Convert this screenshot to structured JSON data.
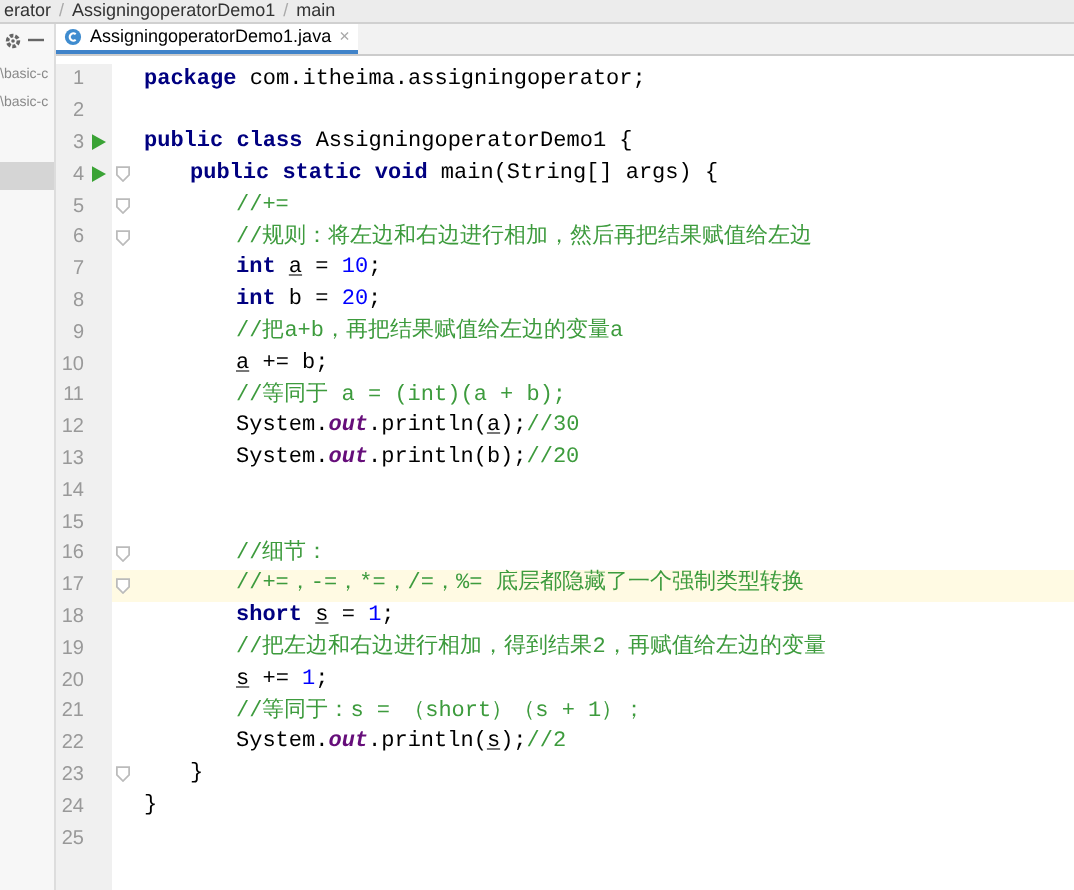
{
  "breadcrumb": {
    "separator": "/",
    "items": [
      "erator",
      "AssigningoperatorDemo1",
      "main"
    ]
  },
  "project_panel": {
    "items": [
      {
        "label": "\\basic-c",
        "selected": false
      },
      {
        "label": "\\basic-c",
        "selected": false
      },
      {
        "selected": true
      }
    ]
  },
  "tabs": [
    {
      "label": "AssigningoperatorDemo1.java",
      "selected": true,
      "close": "×"
    }
  ],
  "lines": [
    {
      "number": "1",
      "tokens": [
        {
          "kind": "kw",
          "text": "package"
        },
        {
          "kind": "plain",
          "text": " com.itheima.assigningoperator;"
        }
      ]
    },
    {
      "number": "2"
    },
    {
      "number": "3",
      "run": true,
      "tokens": [
        {
          "kind": "kw",
          "text": "public class"
        },
        {
          "kind": "plain",
          "text": " AssigningoperatorDemo1 {"
        }
      ],
      "children": [
        {
          "number": "4",
          "run": true,
          "fold": true,
          "tokens": [
            {
              "kind": "kw",
              "text": "public static void"
            },
            {
              "kind": "plain",
              "text": " main(String[] args) {"
            }
          ],
          "children": [
            {
              "number": "5",
              "fold": true,
              "tokens": [
                {
                  "kind": "comment",
                  "text": "//+="
                }
              ]
            },
            {
              "number": "6",
              "fold": true,
              "tokens": [
                {
                  "kind": "comment",
                  "text": "//规则：将左边和右边进行相加，然后再把结果赋值给左边"
                }
              ]
            },
            {
              "number": "7",
              "tokens": [
                {
                  "kind": "kw",
                  "text": "int"
                },
                {
                  "kind": "var",
                  "text": "a"
                },
                {
                  "kind": "plain",
                  "text": "="
                },
                {
                  "kind": "num",
                  "text": "10"
                },
                {
                  "kind": "plain",
                  "text": ";"
                }
              ]
            },
            {
              "number": "8",
              "tokens": [
                {
                  "kind": "kw",
                  "text": "int"
                },
                {
                  "kind": "plain",
                  "text": "b ="
                },
                {
                  "kind": "num",
                  "text": "20"
                },
                {
                  "kind": "plain",
                  "text": ";"
                }
              ]
            },
            {
              "number": "9",
              "tokens": [
                {
                  "kind": "comment",
                  "text": "//把a+b，再把结果赋值给左边的变量a"
                }
              ]
            },
            {
              "number": "10",
              "tokens": [
                {
                  "kind": "var",
                  "text": "a"
                },
                {
                  "kind": "plain",
                  "text": "+= b;"
                }
              ]
            },
            {
              "number": "11",
              "tokens": [
                {
                  "kind": "comment",
                  "text": "//等同于 a = (int)(a + b);"
                }
              ]
            },
            {
              "number": "12",
              "tokens": [
                {
                  "kind": "plain",
                  "text": "System."
                },
                {
                  "kind": "field",
                  "text": "out"
                },
                {
                  "kind": "plain",
                  "text": ".println("
                },
                {
                  "kind": "var",
                  "text": "a"
                },
                {
                  "kind": "plain",
                  "text": ");"
                },
                {
                  "kind": "comment",
                  "text": "//30"
                }
              ]
            },
            {
              "number": "13",
              "tokens": [
                {
                  "kind": "plain",
                  "text": "System."
                },
                {
                  "kind": "field",
                  "text": "out"
                },
                {
                  "kind": "plain",
                  "text": ".println(b);"
                },
                {
                  "kind": "comment",
                  "text": "//20"
                }
              ]
            },
            {
              "number": "14"
            },
            {
              "number": "15"
            },
            {
              "number": "16",
              "fold": true,
              "tokens": [
                {
                  "kind": "comment",
                  "text": "//细节："
                }
              ]
            },
            {
              "number": "17",
              "fold": true,
              "current": true,
              "tokens": [
                {
                  "kind": "comment",
                  "text": "//+=，-=，*=，/=，%= 底层都隐藏了一个强制类型转换"
                }
              ]
            },
            {
              "number": "18",
              "tokens": [
                {
                  "kind": "kw",
                  "text": "short"
                },
                {
                  "kind": "var",
                  "text": "s"
                },
                {
                  "kind": "plain",
                  "text": "="
                },
                {
                  "kind": "num",
                  "text": "1"
                },
                {
                  "kind": "plain",
                  "text": ";"
                }
              ]
            },
            {
              "number": "19",
              "tokens": [
                {
                  "kind": "comment",
                  "text": "//把左边和右边进行相加，得到结果2，再赋值给左边的变量"
                }
              ]
            },
            {
              "number": "20",
              "tokens": [
                {
                  "kind": "var",
                  "text": "s"
                },
                {
                  "kind": "plain",
                  "text": "+="
                },
                {
                  "kind": "num",
                  "text": "1"
                },
                {
                  "kind": "plain",
                  "text": ";"
                }
              ]
            },
            {
              "number": "21",
              "tokens": [
                {
                  "kind": "comment",
                  "text": "//等同于：s = （short）（s + 1）；"
                }
              ]
            },
            {
              "number": "22",
              "tokens": [
                {
                  "kind": "plain",
                  "text": "System."
                },
                {
                  "kind": "field",
                  "text": "out"
                },
                {
                  "kind": "plain",
                  "text": ".println("
                },
                {
                  "kind": "var",
                  "text": "s"
                },
                {
                  "kind": "plain",
                  "text": ");"
                },
                {
                  "kind": "comment",
                  "text": "//2"
                }
              ]
            }
          ]
        },
        {
          "number": "23",
          "fold": true,
          "tokens": [
            {
              "kind": "plain",
              "text": "}"
            }
          ]
        }
      ]
    },
    {
      "number": "24",
      "tokens": [
        {
          "kind": "plain",
          "text": "}"
        }
      ]
    },
    {
      "number": "25"
    }
  ]
}
